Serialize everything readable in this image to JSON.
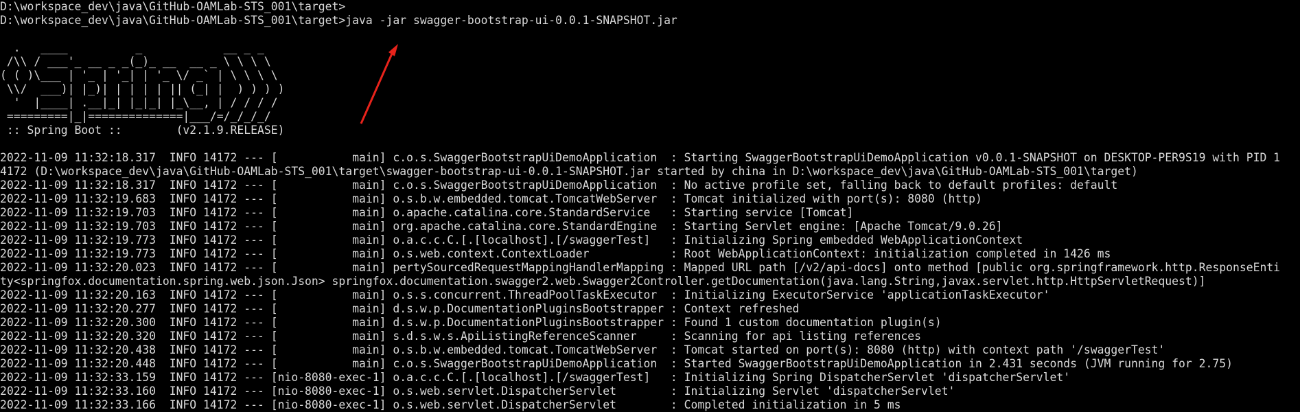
{
  "prompt_lines": [
    "D:\\workspace_dev\\java\\GitHub-OAMLab-STS_001\\target>",
    "D:\\workspace_dev\\java\\GitHub-OAMLab-STS_001\\target>java -jar swagger-bootstrap-ui-0.0.1-SNAPSHOT.jar"
  ],
  "banner_lines": [
    "  .   ____          _            __ _ _",
    " /\\\\ / ___'_ __ _ _(_)_ __  __ _ \\ \\ \\ \\",
    "( ( )\\___ | '_ | '_| | '_ \\/ _` | \\ \\ \\ \\",
    " \\\\/  ___)| |_)| | | | | || (_| |  ) ) ) )",
    "  '  |____| .__|_| |_|_| |_\\__, | / / / /",
    " =========|_|==============|___/=/_/_/_/",
    " :: Spring Boot ::        (v2.1.9.RELEASE)"
  ],
  "log_lines": [
    "2022-11-09 11:32:18.317  INFO 14172 --- [           main] c.o.s.SwaggerBootstrapUiDemoApplication  : Starting SwaggerBootstrapUiDemoApplication v0.0.1-SNAPSHOT on DESKTOP-PER9S19 with PID 1",
    "4172 (D:\\workspace_dev\\java\\GitHub-OAMLab-STS_001\\target\\swagger-bootstrap-ui-0.0.1-SNAPSHOT.jar started by china in D:\\workspace_dev\\java\\GitHub-OAMLab-STS_001\\target)",
    "2022-11-09 11:32:18.317  INFO 14172 --- [           main] c.o.s.SwaggerBootstrapUiDemoApplication  : No active profile set, falling back to default profiles: default",
    "2022-11-09 11:32:19.683  INFO 14172 --- [           main] o.s.b.w.embedded.tomcat.TomcatWebServer  : Tomcat initialized with port(s): 8080 (http)",
    "2022-11-09 11:32:19.703  INFO 14172 --- [           main] o.apache.catalina.core.StandardService   : Starting service [Tomcat]",
    "2022-11-09 11:32:19.703  INFO 14172 --- [           main] org.apache.catalina.core.StandardEngine  : Starting Servlet engine: [Apache Tomcat/9.0.26]",
    "2022-11-09 11:32:19.773  INFO 14172 --- [           main] o.a.c.c.C.[.[localhost].[/swaggerTest]   : Initializing Spring embedded WebApplicationContext",
    "2022-11-09 11:32:19.773  INFO 14172 --- [           main] o.s.web.context.ContextLoader            : Root WebApplicationContext: initialization completed in 1426 ms",
    "2022-11-09 11:32:20.023  INFO 14172 --- [           main] pertySourcedRequestMappingHandlerMapping : Mapped URL path [/v2/api-docs] onto method [public org.springframework.http.ResponseEnti",
    "ty<springfox.documentation.spring.web.json.Json> springfox.documentation.swagger2.web.Swagger2Controller.getDocumentation(java.lang.String,javax.servlet.http.HttpServletRequest)]",
    "2022-11-09 11:32:20.163  INFO 14172 --- [           main] o.s.s.concurrent.ThreadPoolTaskExecutor  : Initializing ExecutorService 'applicationTaskExecutor'",
    "2022-11-09 11:32:20.277  INFO 14172 --- [           main] d.s.w.p.DocumentationPluginsBootstrapper : Context refreshed",
    "2022-11-09 11:32:20.300  INFO 14172 --- [           main] d.s.w.p.DocumentationPluginsBootstrapper : Found 1 custom documentation plugin(s)",
    "2022-11-09 11:32:20.320  INFO 14172 --- [           main] s.d.s.w.s.ApiListingReferenceScanner     : Scanning for api listing references",
    "2022-11-09 11:32:20.438  INFO 14172 --- [           main] o.s.b.w.embedded.tomcat.TomcatWebServer  : Tomcat started on port(s): 8080 (http) with context path '/swaggerTest'",
    "2022-11-09 11:32:20.448  INFO 14172 --- [           main] c.o.s.SwaggerBootstrapUiDemoApplication  : Started SwaggerBootstrapUiDemoApplication in 2.431 seconds (JVM running for 2.75)",
    "2022-11-09 11:32:33.159  INFO 14172 --- [nio-8080-exec-1] o.a.c.c.C.[.[localhost].[/swaggerTest]   : Initializing Spring DispatcherServlet 'dispatcherServlet'",
    "2022-11-09 11:32:33.160  INFO 14172 --- [nio-8080-exec-1] o.s.web.servlet.DispatcherServlet        : Initializing Servlet 'dispatcherServlet'",
    "2022-11-09 11:32:33.166  INFO 14172 --- [nio-8080-exec-1] o.s.web.servlet.DispatcherServlet        : Completed initialization in 5 ms"
  ],
  "colors": {
    "background": "#000000",
    "text": "#d9d9d9",
    "annotation_arrow": "#e8231b"
  },
  "annotation": {
    "shape": "arrow-icon"
  }
}
